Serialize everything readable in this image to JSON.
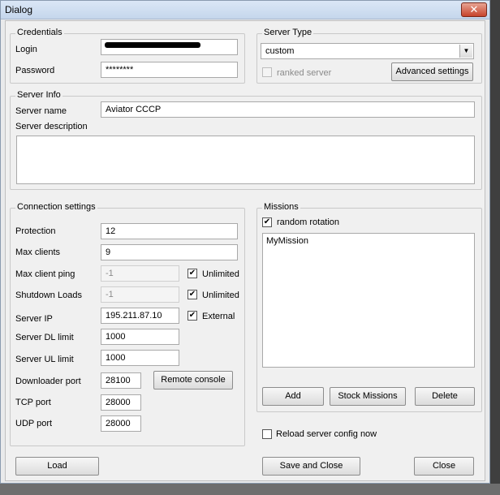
{
  "window": {
    "title": "Dialog",
    "close_glyph": "✕"
  },
  "credentials": {
    "legend": "Credentials",
    "login_label": "Login",
    "login_value": "",
    "password_label": "Password",
    "password_value": "********"
  },
  "server_type": {
    "legend": "Server Type",
    "selected": "custom",
    "ranked_label": "ranked server",
    "advanced_label": "Advanced settings"
  },
  "server_info": {
    "legend": "Server Info",
    "name_label": "Server name",
    "name_value": "Aviator CCCP",
    "description_label": "Server description",
    "description_value": ""
  },
  "connection": {
    "legend": "Connection settings",
    "protection_label": "Protection",
    "protection_value": "12",
    "max_clients_label": "Max clients",
    "max_clients_value": "9",
    "max_ping_label": "Max client ping",
    "max_ping_value": "-1",
    "max_ping_unlimited_label": "Unlimited",
    "shutdown_label": "Shutdown Loads",
    "shutdown_value": "-1",
    "shutdown_unlimited_label": "Unlimited",
    "server_ip_label": "Server IP",
    "server_ip_value": "195.211.87.10",
    "external_label": "External",
    "dl_limit_label": "Server DL limit",
    "dl_limit_value": "1000",
    "ul_limit_label": "Server UL limit",
    "ul_limit_value": "1000",
    "downloader_port_label": "Downloader port",
    "downloader_port_value": "28100",
    "remote_console_label": "Remote console",
    "tcp_port_label": "TCP port",
    "tcp_port_value": "28000",
    "udp_port_label": "UDP port",
    "udp_port_value": "28000"
  },
  "missions": {
    "legend": "Missions",
    "random_rotation_label": "random rotation",
    "items": [
      "MyMission"
    ],
    "add_label": "Add",
    "stock_label": "Stock Missions",
    "delete_label": "Delete"
  },
  "reload_label": "Reload server config now",
  "footer": {
    "load_label": "Load",
    "save_close_label": "Save and Close",
    "close_label": "Close"
  },
  "check_glyph": "✔",
  "arrow_glyph": "▼"
}
